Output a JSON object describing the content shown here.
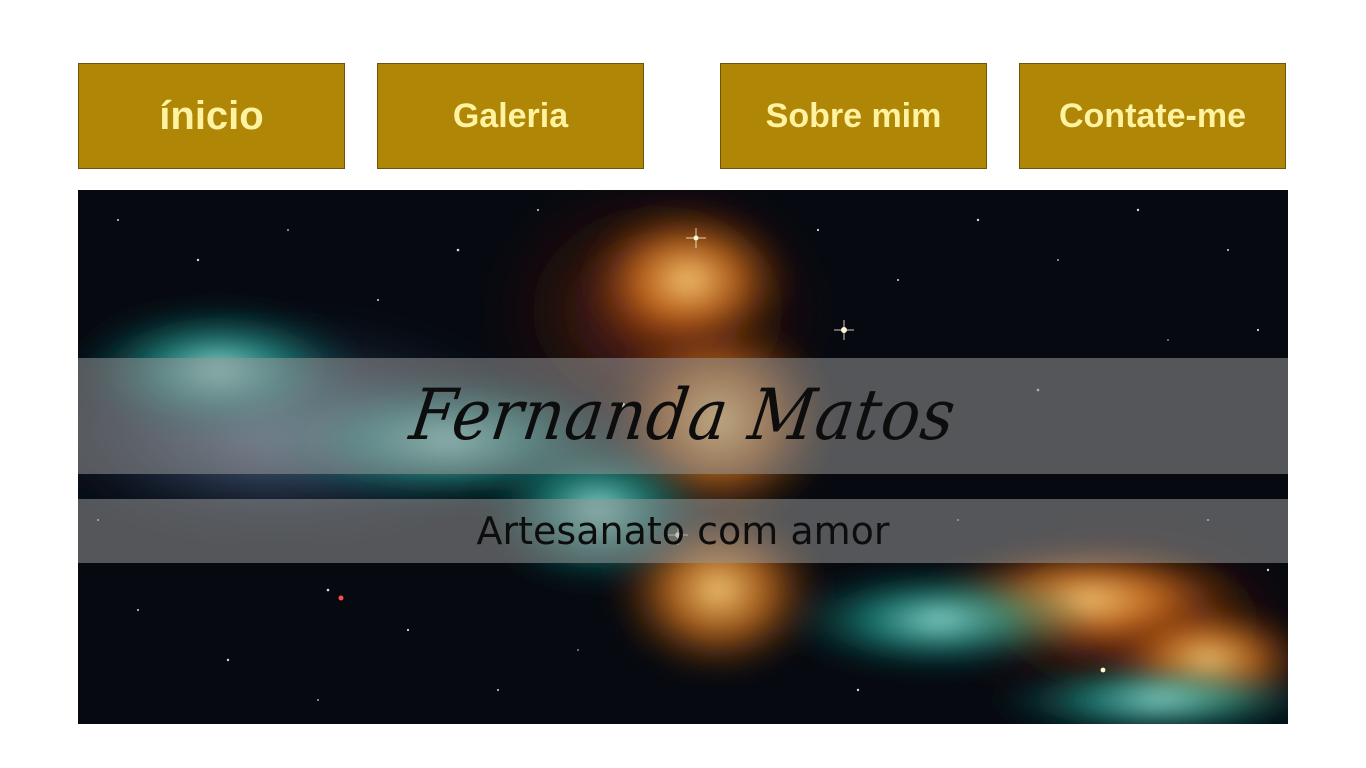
{
  "nav": {
    "items": [
      {
        "label": "ínicio"
      },
      {
        "label": "Galeria"
      },
      {
        "label": "Sobre mim"
      },
      {
        "label": "Contate-me"
      }
    ],
    "colors": {
      "background": "#b08607",
      "text": "#fff2a0"
    }
  },
  "banner": {
    "title": "Fernanda Matos",
    "subtitle": "Artesanato com amor",
    "image": "space-nebula-image"
  }
}
